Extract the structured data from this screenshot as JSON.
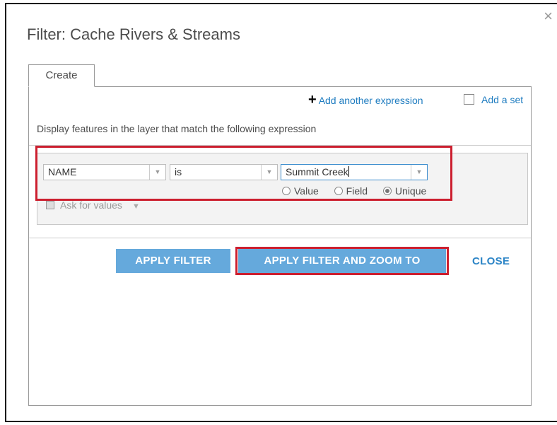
{
  "dialog": {
    "title": "Filter: Cache Rivers & Streams",
    "close_icon": "×"
  },
  "tabs": [
    {
      "label": "Create",
      "active": true
    }
  ],
  "links": {
    "add_expression": "Add another expression",
    "add_set": "Add a set"
  },
  "description": "Display features in the layer that match the following expression",
  "expression": {
    "field": "NAME",
    "operator": "is",
    "value": "Summit Creek",
    "value_type_options": [
      {
        "label": "Value",
        "checked": false
      },
      {
        "label": "Field",
        "checked": false
      },
      {
        "label": "Unique",
        "checked": true
      }
    ],
    "ask_for_values_label": "Ask for values"
  },
  "buttons": {
    "apply": "APPLY FILTER",
    "apply_zoom": "APPLY FILTER AND ZOOM TO",
    "close": "CLOSE"
  },
  "colors": {
    "accent": "#65a9dc",
    "link": "#1e7cc0",
    "highlight": "#cc1f2f"
  }
}
